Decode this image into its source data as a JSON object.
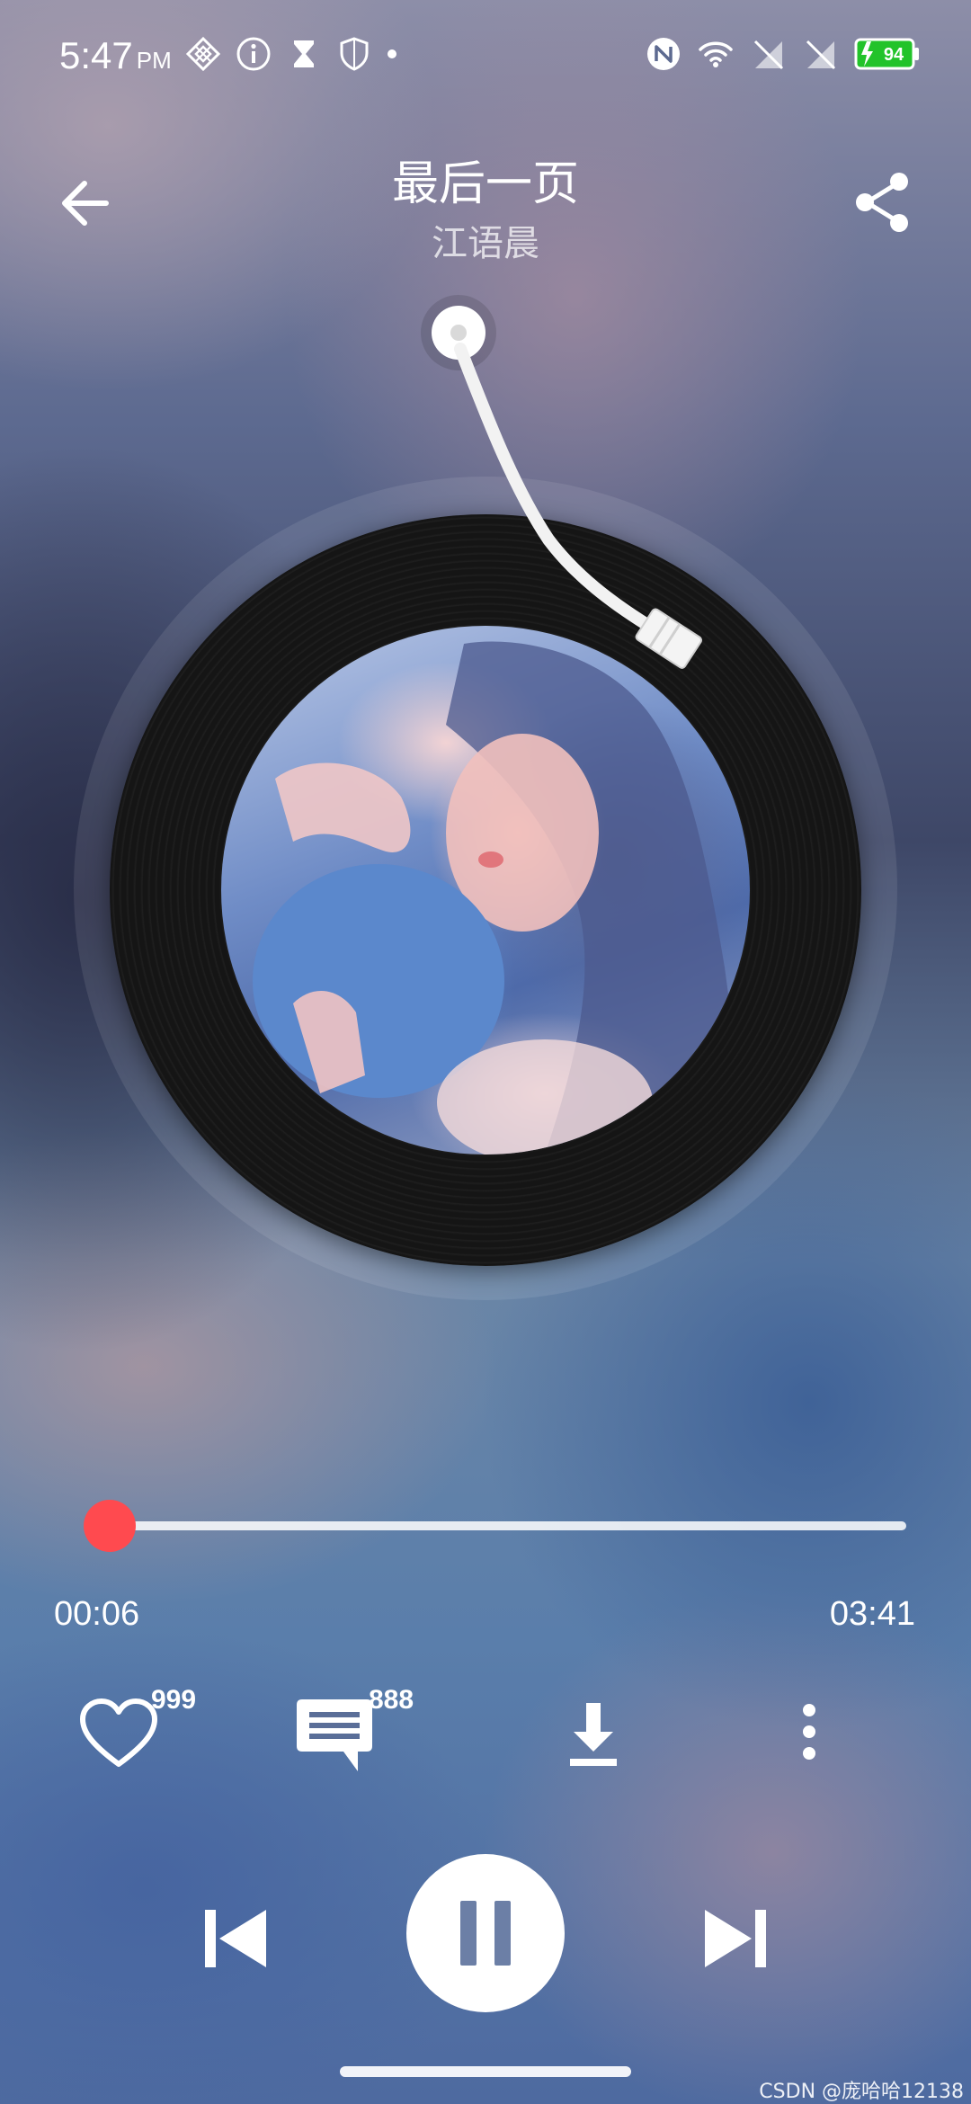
{
  "status_bar": {
    "time": "5:47",
    "ampm": "PM",
    "battery": "94",
    "left_icons": [
      "network-grid-icon",
      "info-icon",
      "hourglass-icon",
      "shield-icon",
      "dot-icon"
    ],
    "right_icons": [
      "nfc-icon",
      "wifi-icon",
      "no-sim-icon",
      "no-sim-icon",
      "battery-charging-icon"
    ],
    "battery_color": "#22c32a"
  },
  "header": {
    "title": "最后一页",
    "artist": "江语晨",
    "back_icon": "back-arrow-icon",
    "share_icon": "share-icon"
  },
  "player": {
    "cover_description_icon": "album-cover",
    "progress_fraction": 0.028,
    "elapsed": "00:06",
    "total": "03:41",
    "accent_color": "#ff4a4f"
  },
  "actions": {
    "like_count": "999",
    "comment_count": "888",
    "like_icon": "heart-icon",
    "comment_icon": "comment-icon",
    "download_icon": "download-icon",
    "more_icon": "more-vertical-icon"
  },
  "controls": {
    "prev_icon": "skip-previous-icon",
    "play_state_icon": "pause-icon",
    "next_icon": "skip-next-icon"
  },
  "watermark": "CSDN @庞哈哈12138"
}
